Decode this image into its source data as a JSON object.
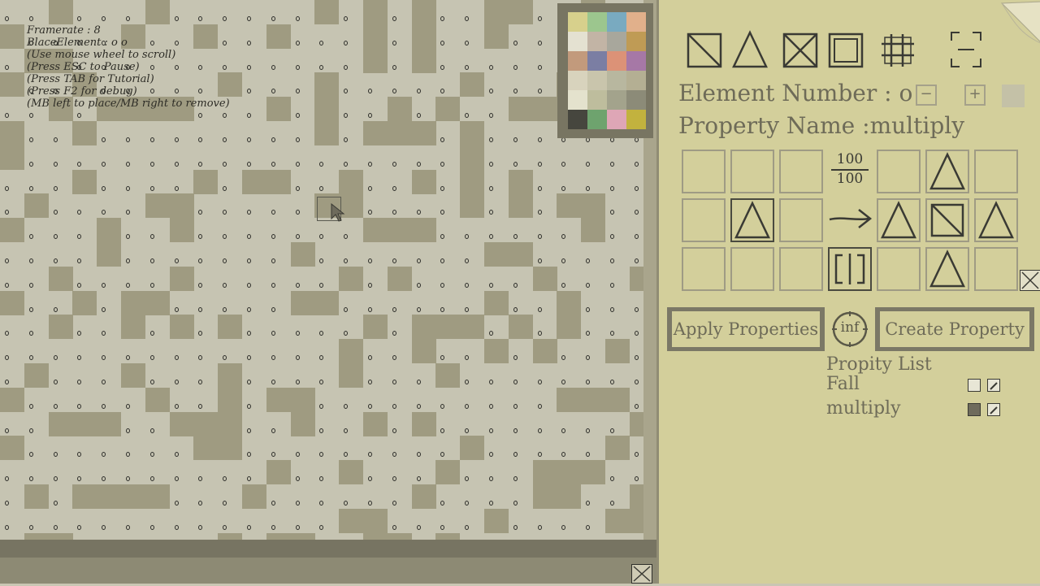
{
  "hud": {
    "framerate": "Framerate : 8",
    "place_element": "BlaceElement : o o",
    "scroll_hint": "(Use mouse wheel to scroll)",
    "pause_hint": "(Press ESC to Pause)",
    "tutorial_hint": "(Press TAB for Tutorial)",
    "debug_hint": "(Press F2 for debug)",
    "mouse_hint": "(MB left to place/MB right to remove)"
  },
  "palette": {
    "colors": [
      "#d7d08c",
      "#9cc68e",
      "#79aac0",
      "#e1b08b",
      "#e4e1d1",
      "#c2b4a5",
      "#a8a79c",
      "#bf9b55",
      "#c29a7c",
      "#7b7ea3",
      "#dc9277",
      "#a678a6",
      "#d8d3bd",
      "#c9c5ac",
      "#b8b79f",
      "#b4af93",
      "#e4e2cd",
      "#bebd9d",
      "#a3a38c",
      "#8c8b78",
      "#46463e",
      "#6ea36e",
      "#dea6b6",
      "#c2b23e"
    ]
  },
  "toolbar": {
    "tools": [
      "square-cross-tool",
      "triangle-tool",
      "square-x-tool",
      "square-double-tool",
      "grid-tool",
      "bracket-select-tool"
    ]
  },
  "element_panel": {
    "element_number_label": "Element Number : o",
    "property_name_label": "Property Name :multiply",
    "ratio_top": "100",
    "ratio_bottom": "100",
    "minus_glyph": "−",
    "plus_glyph": "+"
  },
  "buttons": {
    "apply": "Apply Properties",
    "info": "inf",
    "create": "Create Property"
  },
  "property_list": {
    "title": "Propity List",
    "items": [
      {
        "name": "Fall",
        "checked": false
      },
      {
        "name": "multiply",
        "checked": true
      }
    ]
  }
}
